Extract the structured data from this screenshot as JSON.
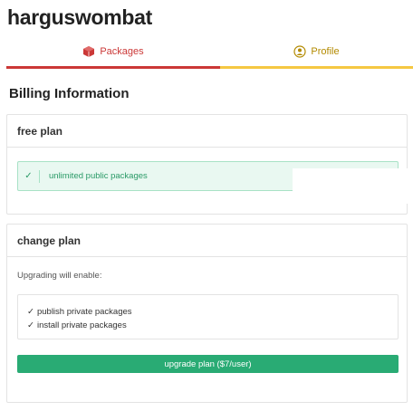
{
  "user": {
    "name": "harguswombat"
  },
  "tabs": [
    {
      "label": "Packages",
      "icon": "package-icon",
      "color": "#cb3837",
      "active": true
    },
    {
      "label": "Profile",
      "icon": "profile-icon",
      "color": "#b38a00",
      "active": false
    }
  ],
  "billing": {
    "title": "Billing Information",
    "free_plan": {
      "title": "free plan",
      "feature": "unlimited public packages"
    },
    "change_plan": {
      "title": "change plan",
      "note": "Upgrading will enable:",
      "benefits": [
        "publish private packages",
        "install private packages"
      ],
      "button_label": "upgrade plan ($7/user)"
    }
  },
  "colors": {
    "accent_red": "#cb3837",
    "accent_yellow": "#f5c842",
    "success_green": "#29ab74"
  }
}
